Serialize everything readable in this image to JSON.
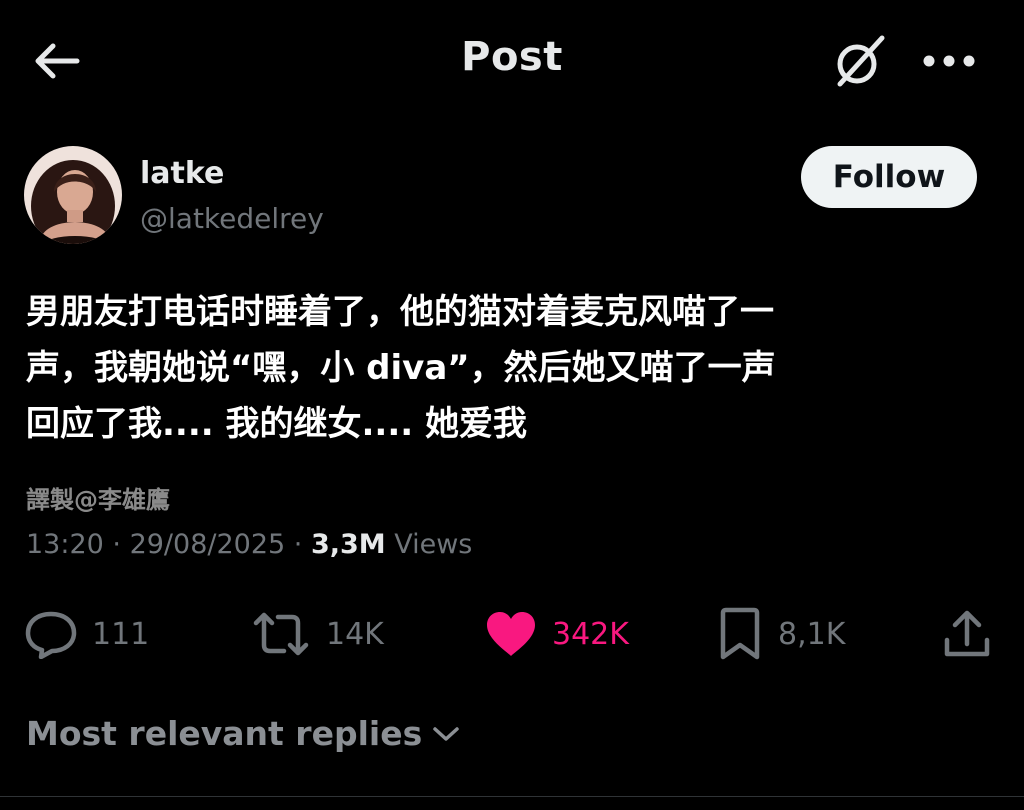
{
  "header": {
    "title": "Post",
    "back_icon": "arrow-left-icon",
    "grok_icon": "grok-slash-circle-icon",
    "more_icon": "more-horizontal-icon"
  },
  "author": {
    "display_name": "latke",
    "handle": "@latkedelrey",
    "follow_label": "Follow"
  },
  "post": {
    "text": "男朋友打电话时睡着了，他的猫对着麦克风喵了一\n声，我朝她说“嘿，小 diva”，然后她又喵了一声\n回应了我.... 我的继女.... 她爱我",
    "watermark": "譯製@李雄鷹"
  },
  "meta": {
    "time": "13:20",
    "separator": " · ",
    "date": "29/08/2025",
    "views_count": "3,3M",
    "views_label": " Views"
  },
  "actions": {
    "replies": "111",
    "reposts": "14K",
    "likes": "342K",
    "bookmarks": "8,1K"
  },
  "replies_sort": {
    "label": "Most relevant replies"
  },
  "colors": {
    "background": "#000000",
    "text_primary": "#e7e9ea",
    "text_secondary": "#71767b",
    "like_pink": "#f91880",
    "follow_bg": "#eff3f4"
  }
}
